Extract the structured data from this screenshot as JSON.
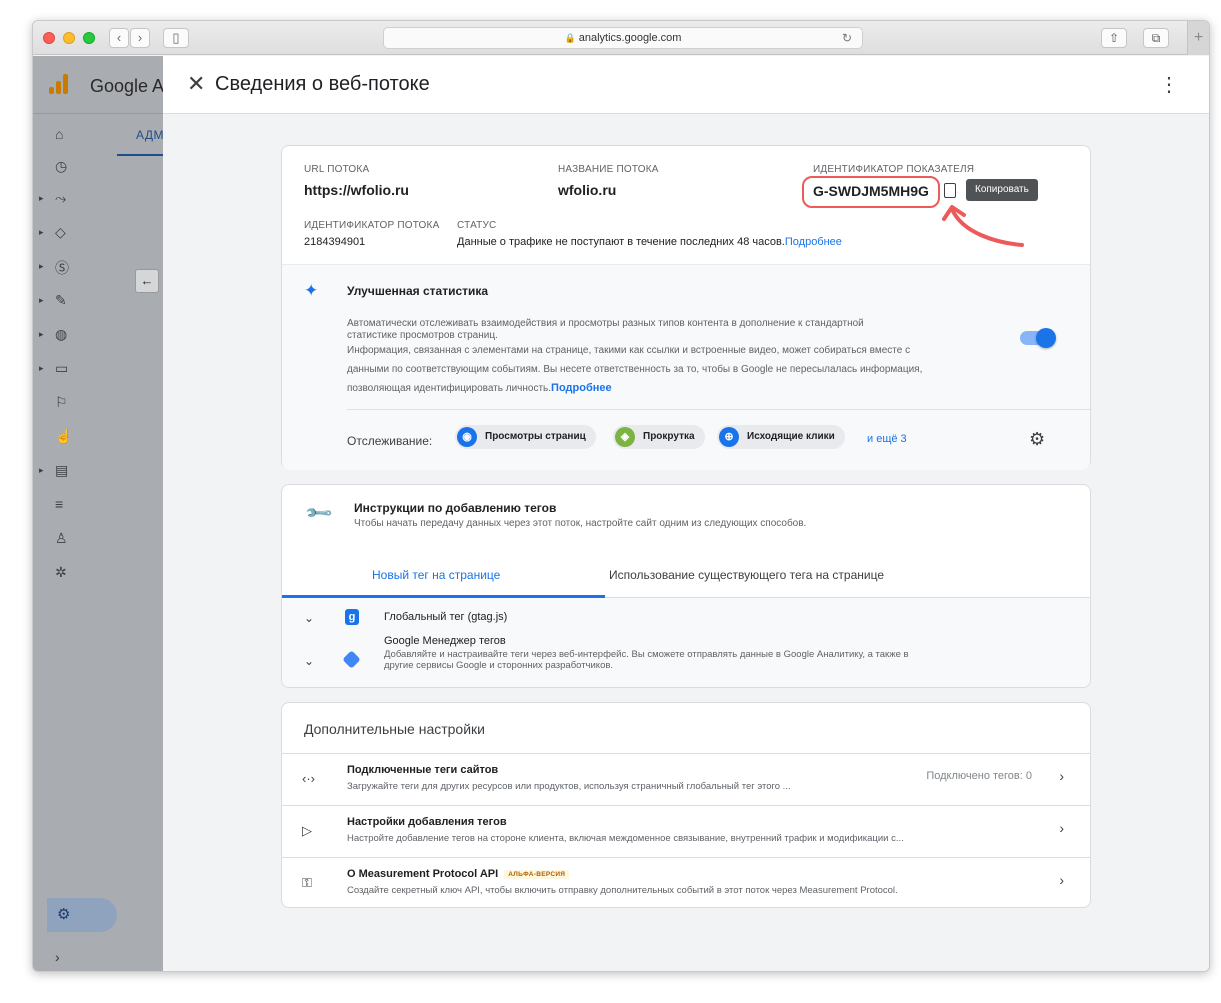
{
  "browser": {
    "url": "analytics.google.com"
  },
  "app": {
    "name": "Google A",
    "tab_label": "АДМ",
    "rail_icons": [
      "home-icon",
      "clock-icon",
      "explore-icon",
      "tag-icon",
      "dollar-icon",
      "pen-icon",
      "globe-icon",
      "screen-icon",
      "flag-icon",
      "touch-icon",
      "report-icon",
      "list-icon",
      "people-icon",
      "bug-icon"
    ]
  },
  "dialog": {
    "title": "Сведения о веб-потоке"
  },
  "stream": {
    "url_label": "URL потока",
    "url_value": "https://wfolio.ru",
    "name_label": "Название потока",
    "name_value": "wfolio.ru",
    "mid_label": "Идентификатор показателя",
    "mid_value": "G-SWDJM5MH9G",
    "copy_tooltip": "Копировать",
    "id_label": "Идентификатор потока",
    "id_value": "2184394901",
    "status_label": "Статус",
    "status_value": "Данные о трафике не поступают в течение последних 48 часов.",
    "status_link": "Подробнее"
  },
  "enhanced": {
    "title": "Улучшенная статистика",
    "line1": "Автоматически отслеживать взаимодействия и просмотры разных типов контента в дополнение к стандартной",
    "line2": "статистике просмотров страниц.",
    "line3": "Информация, связанная с элементами на странице, такими как ссылки и встроенные видео, может собираться вместе с",
    "line4": "данными по соответствующим событиям. Вы несете ответственность за то, чтобы в Google не пересылалась информация,",
    "line5": "позволяющая идентифицировать личность.",
    "link": "Подробнее",
    "toggle_on": true,
    "tracking_label": "Отслеживание:",
    "chips": [
      "Просмотры страниц",
      "Прокрутка",
      "Исходящие клики"
    ],
    "more": "и ещё 3"
  },
  "tagging": {
    "title": "Инструкции по добавлению тегов",
    "subtitle": "Чтобы начать передачу данных через этот поток, настройте сайт одним из следующих способов.",
    "tab_new": "Новый тег на странице",
    "tab_existing": "Использование существующего тега на странице",
    "gtag_name": "Глобальный тег (gtag.js)",
    "gtm_name": "Google Менеджер тегов",
    "gtm_desc1": "Добавляйте и настраивайте теги через веб-интерфейс. Вы сможете отправлять данные в Google Аналитику, а также в",
    "gtm_desc2": "другие сервисы Google и сторонних разработчиков."
  },
  "additional": {
    "title": "Дополнительные настройки",
    "rows": [
      {
        "name": "Подключенные теги сайтов",
        "desc": "Загружайте теги для других ресурсов или продуктов, используя страничный глобальный тег этого ...",
        "right": "Подключено тегов: 0"
      },
      {
        "name": "Настройки добавления тегов",
        "desc": "Настройте добавление тегов на стороне клиента, включая междоменное связывание, внутренний трафик и модификации с..."
      },
      {
        "name": "О Measurement Protocol API",
        "badge": "АЛЬФА-ВЕРСИЯ",
        "desc": "Создайте секретный ключ API, чтобы включить отправку дополнительных событий в этот поток через Measurement Protocol."
      }
    ]
  },
  "colors": {
    "accent": "#1a73e8",
    "highlight": "#ec5a5a"
  }
}
